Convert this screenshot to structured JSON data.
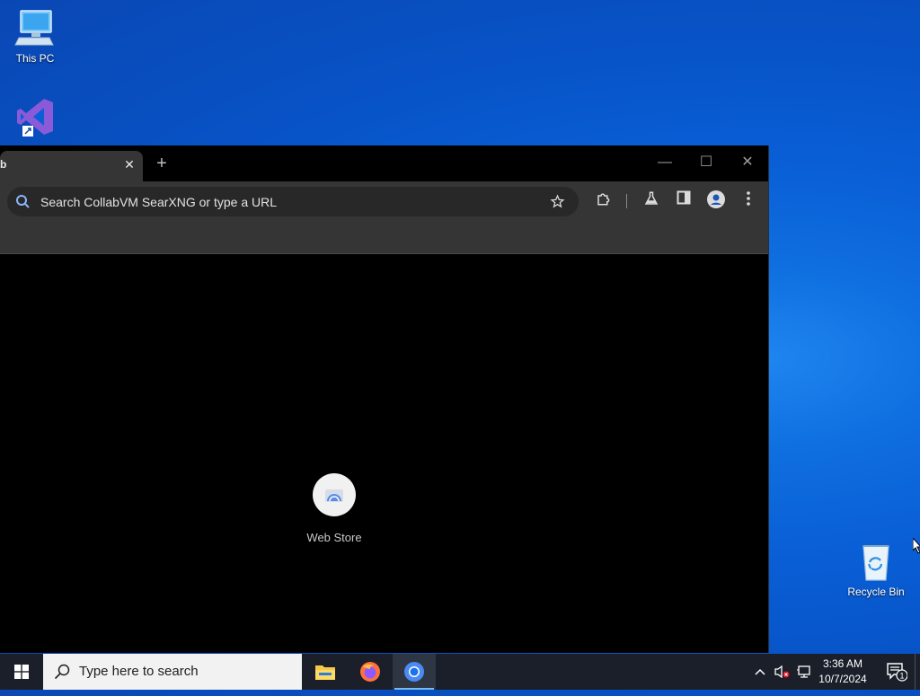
{
  "desktop": {
    "icons": [
      {
        "label": "This PC",
        "icon": "computer-icon"
      },
      {
        "label": "",
        "icon": "visual-studio-icon"
      },
      {
        "label": "Recycle Bin",
        "icon": "recycle-bin-icon"
      }
    ]
  },
  "browser": {
    "tab": {
      "title": "b",
      "close": "✕"
    },
    "new_tab": "+",
    "window_controls": {
      "minimize": "—",
      "maximize": "☐",
      "close": "✕"
    },
    "omnibox": {
      "placeholder": "Search CollabVM SearXNG or type a URL"
    },
    "toolbar_icons": [
      "bookmark-star-icon",
      "extensions-icon",
      "labs-flask-icon",
      "side-panel-icon",
      "profile-icon",
      "more-menu-icon"
    ],
    "shortcuts": [
      {
        "label": "Web Store",
        "icon": "web-store-icon"
      }
    ]
  },
  "taskbar": {
    "search_placeholder": "Type here to search",
    "apps": [
      "file-explorer-icon",
      "firefox-icon",
      "chrome-icon"
    ],
    "active_app": "chrome-icon",
    "clock": {
      "time": "3:36 AM",
      "date": "10/7/2024"
    },
    "notifications_count": "1"
  },
  "colors": {
    "accent": "#76b9ed",
    "desktop": "#0a5fd6",
    "browser_chrome": "#353535"
  }
}
